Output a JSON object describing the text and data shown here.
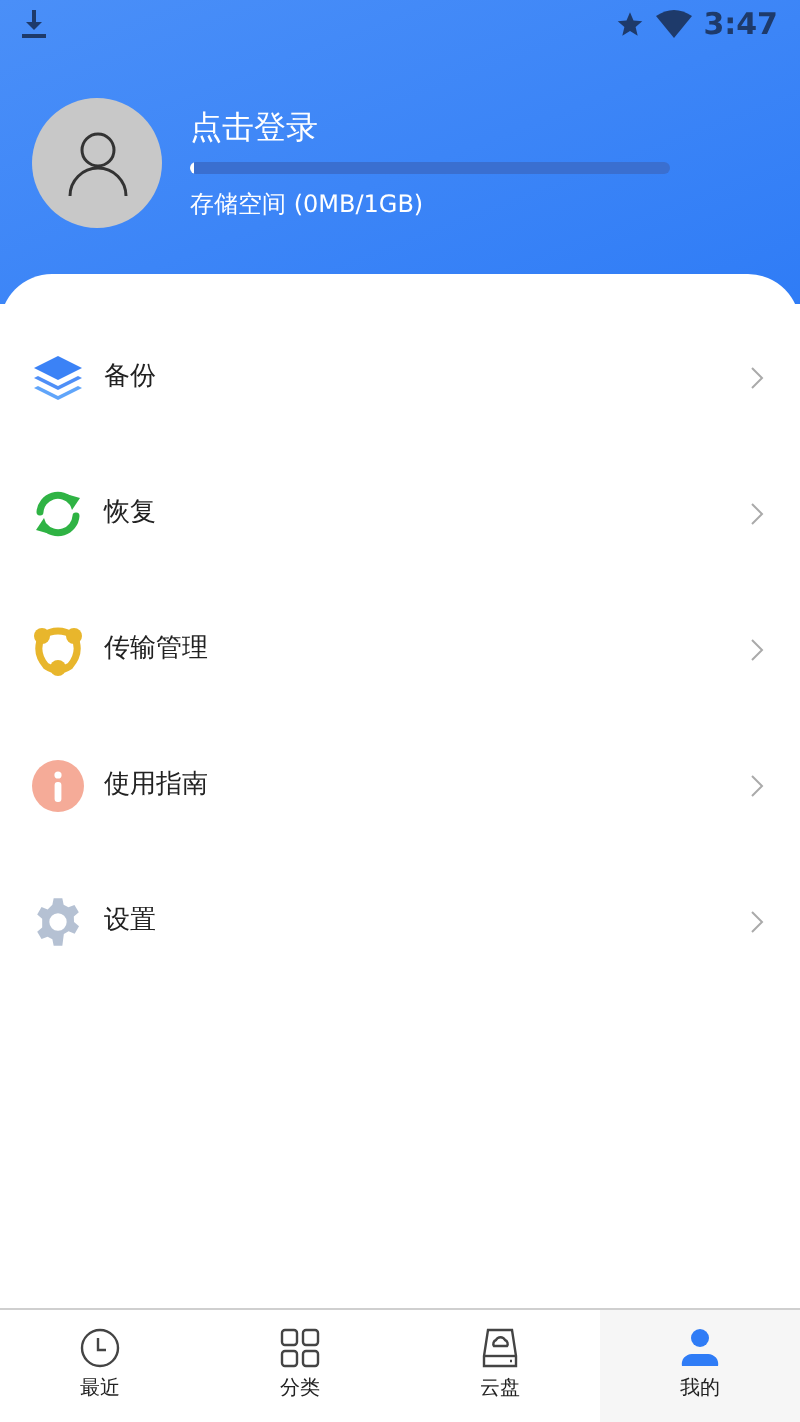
{
  "status_bar": {
    "time": "3:47"
  },
  "profile": {
    "name": "点击登录",
    "storage": {
      "level": 0.01,
      "label": "存储空间 (0MB/1GB)"
    }
  },
  "menu": [
    {
      "kind": "backup",
      "label": "备份"
    },
    {
      "kind": "restore",
      "label": "恢复"
    },
    {
      "kind": "transfer",
      "label": "传输管理"
    },
    {
      "kind": "guide",
      "label": "使用指南"
    },
    {
      "kind": "settings",
      "label": "设置"
    }
  ],
  "tabs": [
    {
      "kind": "recent",
      "label": "最近",
      "selected": false
    },
    {
      "kind": "category",
      "label": "分类",
      "selected": false
    },
    {
      "kind": "cloud",
      "label": "云盘",
      "selected": false
    },
    {
      "kind": "mine",
      "label": "我的",
      "selected": true
    }
  ]
}
